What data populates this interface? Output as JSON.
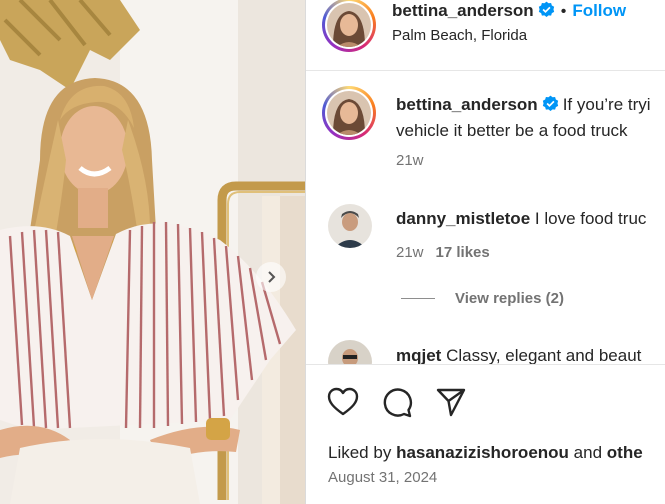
{
  "post": {
    "author": "bettina_anderson",
    "follow_label": "Follow",
    "separator": "•",
    "location": "Palm Beach, Florida",
    "caption_line1": "If you’re tryi",
    "caption_line2": "vehicle it better be a food truck",
    "caption_age": "21w"
  },
  "comments": [
    {
      "username": "danny_mistletoe",
      "text": "I love food truc",
      "age": "21w",
      "likes": "17 likes",
      "view_replies": "View replies (2)"
    },
    {
      "username": "mqjet",
      "text": "Classy, elegant and beaut"
    }
  ],
  "footer": {
    "liked_prefix": "Liked by",
    "liked_user": "hasanazizishoroenou",
    "liked_and": "and",
    "liked_others": "othe",
    "date": "August 31, 2024"
  },
  "icons": {
    "like": "heart-icon",
    "comment": "comment-icon",
    "share": "share-icon",
    "verified": "verified-badge-icon",
    "carousel": "chevron-right-icon"
  },
  "colors": {
    "link_blue": "#0095f6",
    "verified_blue": "#0095f6",
    "text": "#262626",
    "secondary": "#737373"
  }
}
